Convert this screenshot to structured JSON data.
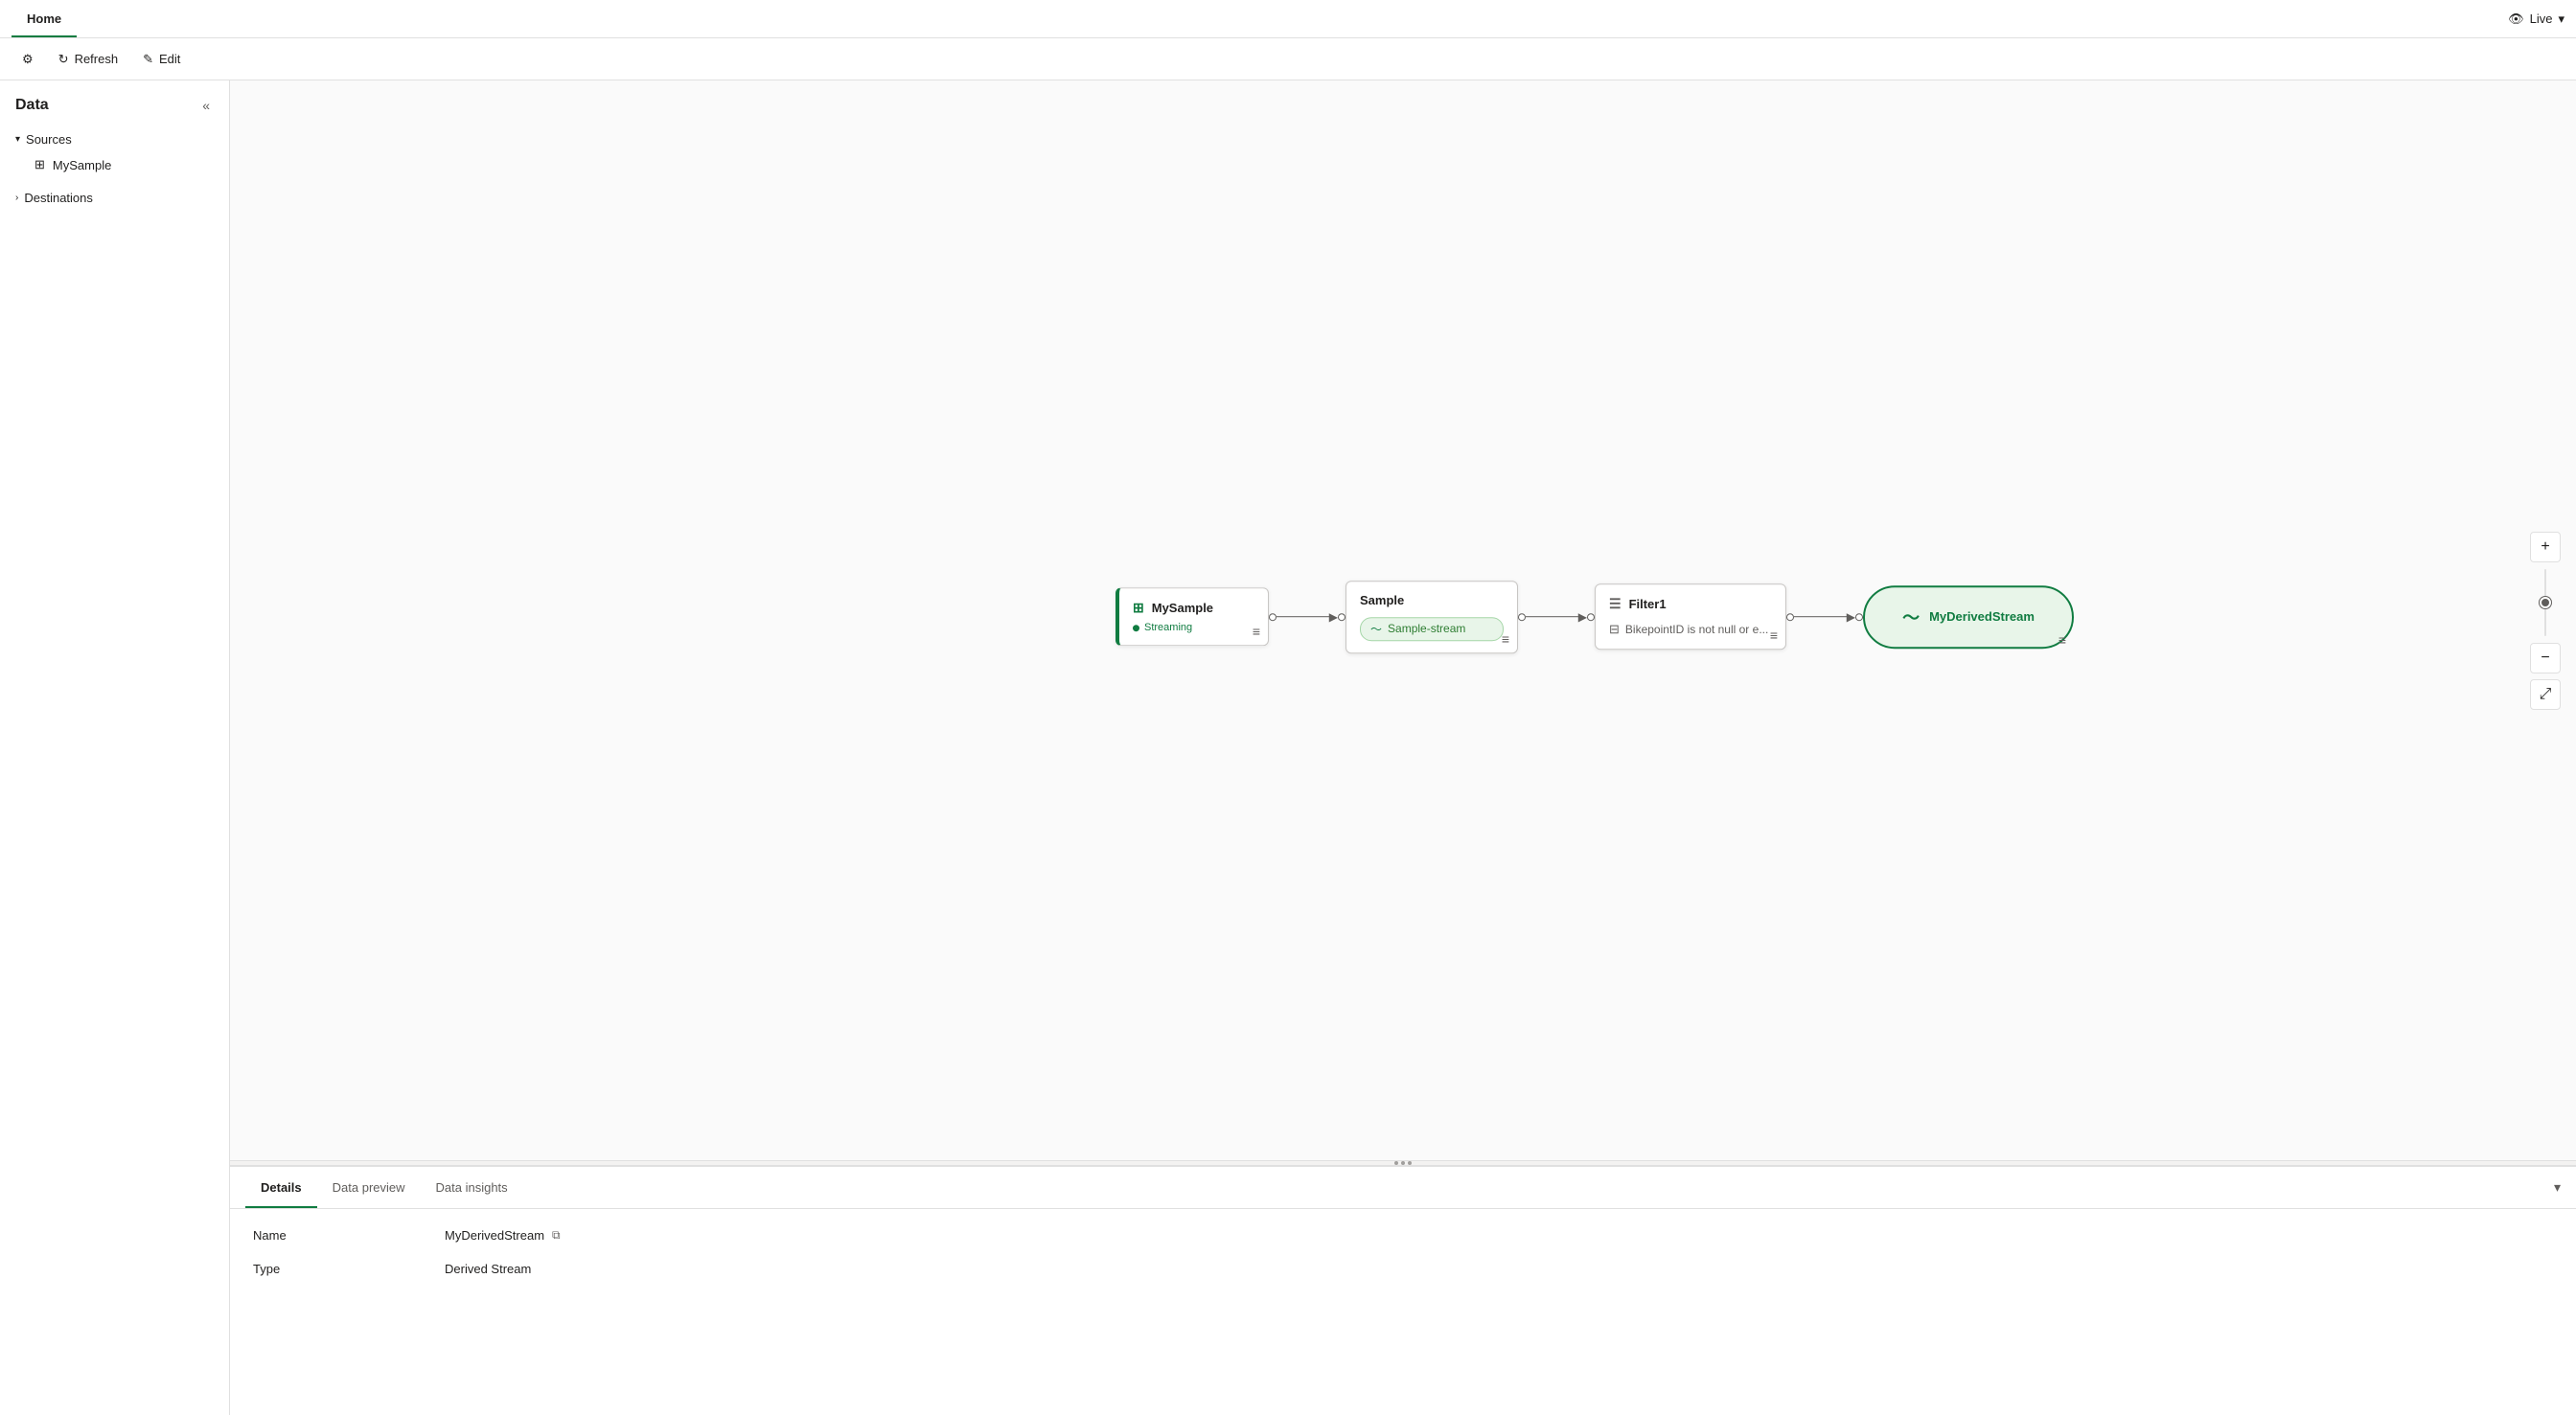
{
  "tabs": [
    {
      "label": "Home",
      "active": true
    }
  ],
  "live_badge": {
    "label": "Live",
    "icon": "👁"
  },
  "toolbar": {
    "settings_icon": "⚙",
    "refresh_label": "Refresh",
    "edit_label": "Edit"
  },
  "sidebar": {
    "title": "Data",
    "collapse_icon": "«",
    "sections": [
      {
        "label": "Sources",
        "expanded": true,
        "items": [
          {
            "label": "MySample",
            "icon": "▦"
          }
        ]
      },
      {
        "label": "Destinations",
        "expanded": false,
        "items": []
      }
    ]
  },
  "canvas": {
    "nodes": [
      {
        "id": "mysample",
        "title": "MySample",
        "status": "Streaming",
        "type": "source"
      },
      {
        "id": "sample",
        "title": "Sample",
        "stream": "Sample-stream",
        "type": "sample"
      },
      {
        "id": "filter1",
        "title": "Filter1",
        "condition": "BikepointID is not null or e...",
        "type": "filter"
      },
      {
        "id": "myderivedstream",
        "title": "MyDerivedStream",
        "type": "derived"
      }
    ]
  },
  "bottom_panel": {
    "tabs": [
      {
        "label": "Details",
        "active": true
      },
      {
        "label": "Data preview",
        "active": false
      },
      {
        "label": "Data insights",
        "active": false
      }
    ],
    "details": {
      "name_label": "Name",
      "name_value": "MyDerivedStream",
      "type_label": "Type",
      "type_value": "Derived Stream"
    }
  }
}
